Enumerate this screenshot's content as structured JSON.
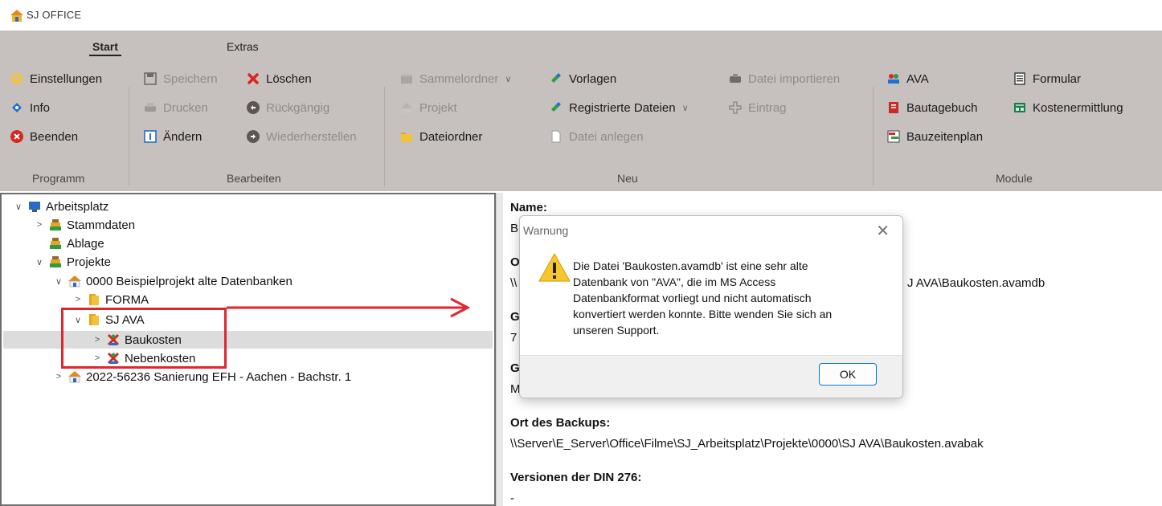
{
  "app": {
    "title": "SJ OFFICE"
  },
  "ribbon": {
    "tabs": [
      {
        "label": "Start",
        "active": true
      },
      {
        "label": "Extras",
        "active": false
      }
    ],
    "groups": {
      "programm": {
        "label": "Programm",
        "items": [
          {
            "label": "Einstellungen",
            "icon": "gear-icon",
            "enabled": true
          },
          {
            "label": "Info",
            "icon": "info-icon",
            "enabled": true
          },
          {
            "label": "Beenden",
            "icon": "close-circle-icon",
            "enabled": true
          }
        ]
      },
      "bearbeiten": {
        "label": "Bearbeiten",
        "items": [
          {
            "label": "Speichern",
            "icon": "save-icon",
            "enabled": false
          },
          {
            "label": "Drucken",
            "icon": "printer-icon",
            "enabled": false
          },
          {
            "label": "Ändern",
            "icon": "edit-icon",
            "enabled": true
          },
          {
            "label": "Löschen",
            "icon": "delete-icon",
            "enabled": true
          },
          {
            "label": "Rückgängig",
            "icon": "undo-icon",
            "enabled": false
          },
          {
            "label": "Wiederherstellen",
            "icon": "redo-icon",
            "enabled": false
          }
        ]
      },
      "neu": {
        "label": "Neu",
        "items": [
          {
            "label": "Sammelordner",
            "icon": "collection-folder-icon",
            "enabled": false,
            "dropdown": true
          },
          {
            "label": "Projekt",
            "icon": "project-icon",
            "enabled": false
          },
          {
            "label": "Dateiordner",
            "icon": "folder-icon",
            "enabled": true
          },
          {
            "label": "Vorlagen",
            "icon": "template-icon",
            "enabled": true
          },
          {
            "label": "Registrierte Dateien",
            "icon": "registered-files-icon",
            "enabled": true,
            "dropdown": true
          },
          {
            "label": "Datei anlegen",
            "icon": "new-file-icon",
            "enabled": false
          },
          {
            "label": "Datei importieren",
            "icon": "import-icon",
            "enabled": false
          },
          {
            "label": "Eintrag",
            "icon": "entry-icon",
            "enabled": false
          }
        ]
      },
      "module": {
        "label": "Module",
        "items": [
          {
            "label": "AVA",
            "icon": "ava-icon",
            "enabled": true
          },
          {
            "label": "Bautagebuch",
            "icon": "diary-icon",
            "enabled": true
          },
          {
            "label": "Bauzeitenplan",
            "icon": "schedule-icon",
            "enabled": true
          },
          {
            "label": "Formular",
            "icon": "form-icon",
            "enabled": true
          },
          {
            "label": "Kostenermittlung",
            "icon": "cost-icon",
            "enabled": true
          }
        ]
      }
    }
  },
  "tree": {
    "nodes": [
      {
        "label": "Arbeitsplatz",
        "expanded": true,
        "level": 0,
        "icon": "computer-icon"
      },
      {
        "label": "Stammdaten",
        "expanded": false,
        "level": 1,
        "icon": "stack-icon"
      },
      {
        "label": "Ablage",
        "expanded": null,
        "level": 1,
        "icon": "stack-icon"
      },
      {
        "label": "Projekte",
        "expanded": true,
        "level": 1,
        "icon": "stack-icon"
      },
      {
        "label": "0000 Beispielprojekt alte Datenbanken",
        "expanded": true,
        "level": 2,
        "icon": "house-icon"
      },
      {
        "label": "FORMA",
        "expanded": false,
        "level": 3,
        "icon": "folder-icon"
      },
      {
        "label": "SJ AVA",
        "expanded": true,
        "level": 3,
        "icon": "folder-icon"
      },
      {
        "label": "Baukosten",
        "expanded": false,
        "level": 4,
        "icon": "ava-file-icon",
        "selected": true
      },
      {
        "label": "Nebenkosten",
        "expanded": false,
        "level": 4,
        "icon": "ava-file-icon"
      },
      {
        "label": "2022-56236 Sanierung EFH - Aachen - Bachstr. 1",
        "expanded": false,
        "level": 2,
        "icon": "house-icon"
      }
    ]
  },
  "detail": {
    "name_label": "Name:",
    "name_value": "B",
    "o_label": "O",
    "o_value_left": "\\\\",
    "o_value_right": "J AVA\\Baukosten.avamdb",
    "g1_label": "G",
    "g1_value": "7",
    "g2_label": "G",
    "g2_value": "M",
    "backup_label": "Ort des Backups:",
    "backup_value": "\\\\Server\\E_Server\\Office\\Filme\\SJ_Arbeitsplatz\\Projekte\\0000\\SJ AVA\\Baukosten.avabak",
    "din_label": "Versionen der DIN 276:",
    "din_value": "-"
  },
  "dialog": {
    "title": "Warnung",
    "close_glyph": "✕",
    "message_lines": [
      "Die Datei 'Baukosten.avamdb' ist eine sehr alte",
      "Datenbank von \"AVA\", die im MS Access",
      "Datenbankformat vorliegt und nicht automatisch",
      "konvertiert werden konnte. Bitte wenden Sie sich an",
      "unseren Support."
    ],
    "ok_label": "OK"
  },
  "colors": {
    "ribbon_bg": "#c6c1be",
    "annotation_red": "#e0262d",
    "accent": "#0078d4"
  }
}
